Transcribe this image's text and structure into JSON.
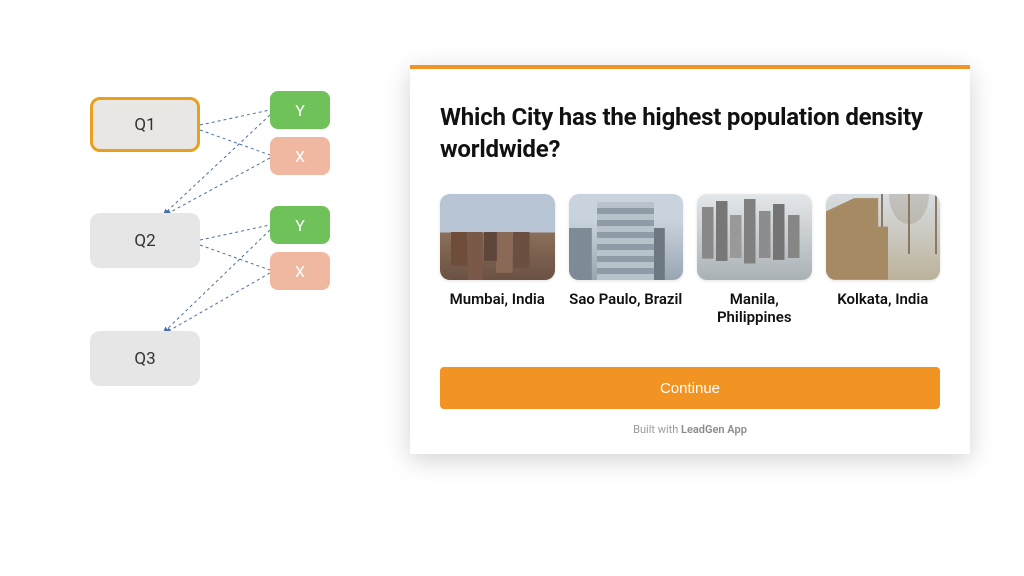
{
  "flow": {
    "q1": "Q1",
    "q2": "Q2",
    "q3": "Q3",
    "y": "Y",
    "x": "X"
  },
  "quiz": {
    "question": "Which City has the highest population density worldwide?",
    "options": [
      {
        "label": "Mumbai, India"
      },
      {
        "label": "Sao Paulo, Brazil"
      },
      {
        "label": "Manila, Philippines"
      },
      {
        "label": "Kolkata, India"
      }
    ],
    "continue_label": "Continue",
    "built_with_prefix": "Built with ",
    "built_with_brand": "LeadGen App"
  }
}
